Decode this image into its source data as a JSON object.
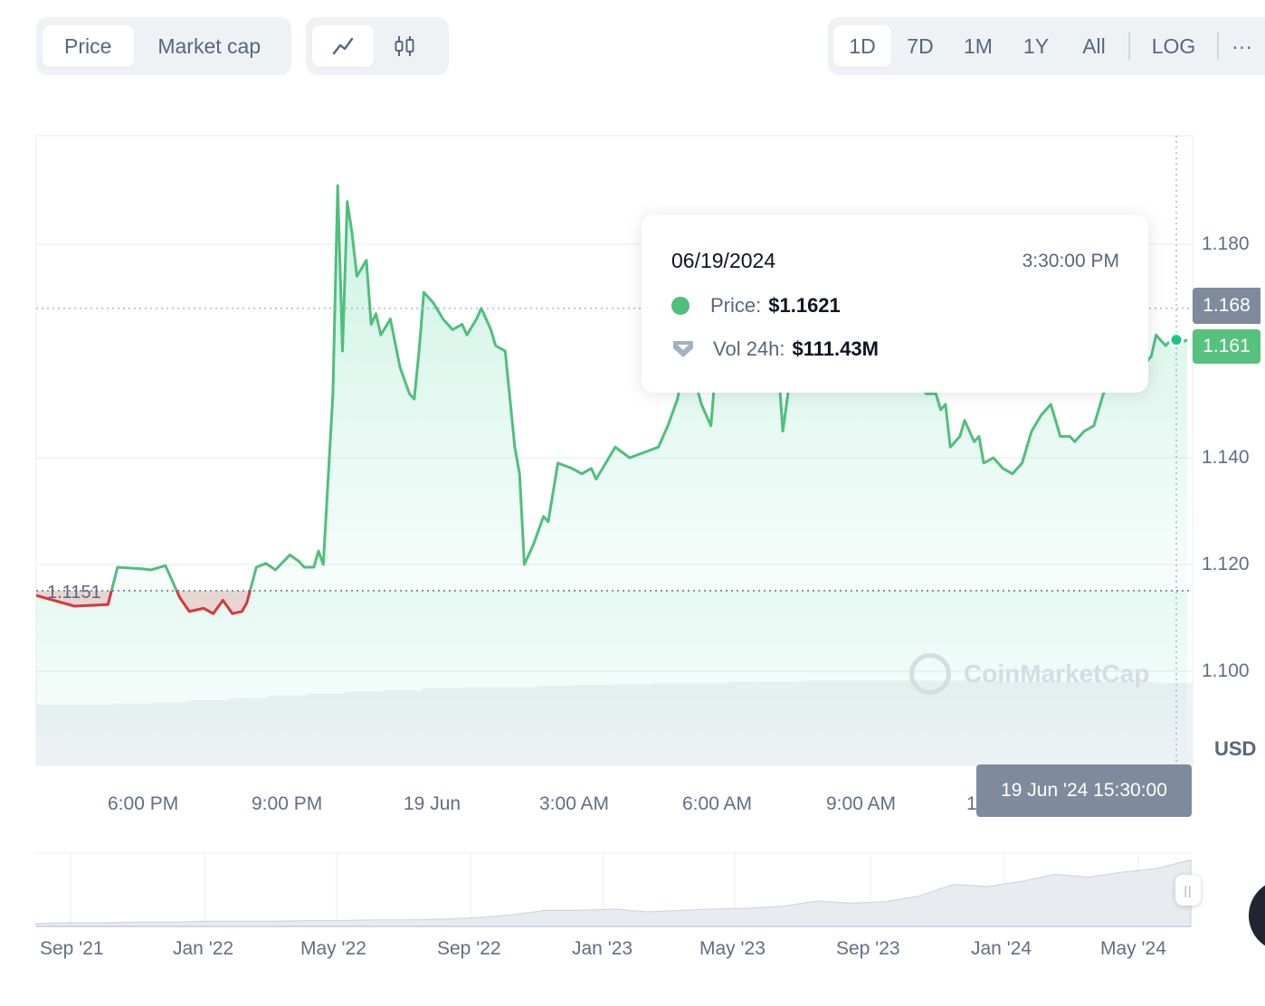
{
  "toolbar": {
    "type_tabs": [
      "Price",
      "Market cap"
    ],
    "active_type": "Price",
    "range_tabs": [
      "1D",
      "7D",
      "1M",
      "1Y",
      "All"
    ],
    "active_range": "1D",
    "log_label": "LOG",
    "more_label": "···",
    "view_icons": [
      "line-chart-icon",
      "candlestick-icon"
    ]
  },
  "tooltip": {
    "date": "06/19/2024",
    "time": "3:30:00 PM",
    "price_label": "Price:",
    "price_value": "$1.1621",
    "volume_label": "Vol 24h:",
    "volume_value": "$111.43M"
  },
  "chart_data": {
    "type": "area",
    "currency": "USD",
    "baseline": 1.1151,
    "baseline_label": "1.1151",
    "ylim": [
      1.082,
      1.19
    ],
    "yticks": [
      1.1,
      1.12,
      1.14,
      1.18
    ],
    "ytick_labels": [
      "1.100",
      "1.120",
      "1.140",
      "1.180"
    ],
    "xticks": [
      "6:00 PM",
      "9:00 PM",
      "19 Jun",
      "3:00 AM",
      "6:00 AM",
      "9:00 AM",
      "1"
    ],
    "current_price_label": "1.161",
    "hover_price_label": "1.168",
    "hover_time_label": "19 Jun '24 15:30:00",
    "up_color": "#16c784",
    "down_color": "#ea3943",
    "x_start_hours": 15.7,
    "x_end_hours": 39.75,
    "series": [
      {
        "points": [
          [
            15.7,
            1.1142
          ],
          [
            16.5,
            1.1122
          ],
          [
            17.2,
            1.1125
          ],
          [
            17.4,
            1.1195
          ],
          [
            17.9,
            1.1192
          ],
          [
            18.1,
            1.119
          ],
          [
            18.4,
            1.1198
          ],
          [
            18.7,
            1.1138
          ],
          [
            18.9,
            1.1112
          ],
          [
            19.2,
            1.1118
          ],
          [
            19.4,
            1.1108
          ],
          [
            19.6,
            1.1133
          ],
          [
            19.8,
            1.1108
          ],
          [
            20.0,
            1.1112
          ],
          [
            20.1,
            1.1128
          ],
          [
            20.3,
            1.1195
          ],
          [
            20.5,
            1.1202
          ],
          [
            20.7,
            1.119
          ],
          [
            21.0,
            1.1218
          ],
          [
            21.2,
            1.1205
          ],
          [
            21.3,
            1.1195
          ],
          [
            21.5,
            1.1195
          ],
          [
            21.6,
            1.1225
          ],
          [
            21.7,
            1.12
          ],
          [
            21.9,
            1.152
          ],
          [
            22.0,
            1.191
          ],
          [
            22.1,
            1.16
          ],
          [
            22.2,
            1.188
          ],
          [
            22.3,
            1.182
          ],
          [
            22.4,
            1.174
          ],
          [
            22.6,
            1.177
          ],
          [
            22.7,
            1.165
          ],
          [
            22.8,
            1.167
          ],
          [
            22.9,
            1.163
          ],
          [
            23.1,
            1.166
          ],
          [
            23.3,
            1.157
          ],
          [
            23.5,
            1.152
          ],
          [
            23.6,
            1.151
          ],
          [
            23.7,
            1.16
          ],
          [
            23.8,
            1.171
          ],
          [
            24.0,
            1.169
          ],
          [
            24.2,
            1.166
          ],
          [
            24.4,
            1.164
          ],
          [
            24.6,
            1.165
          ],
          [
            24.7,
            1.163
          ],
          [
            24.9,
            1.166
          ],
          [
            25.0,
            1.168
          ],
          [
            25.2,
            1.164
          ],
          [
            25.3,
            1.161
          ],
          [
            25.5,
            1.16
          ],
          [
            25.7,
            1.142
          ],
          [
            25.8,
            1.137
          ],
          [
            25.9,
            1.12
          ],
          [
            26.1,
            1.124
          ],
          [
            26.3,
            1.129
          ],
          [
            26.4,
            1.128
          ],
          [
            26.6,
            1.139
          ],
          [
            26.9,
            1.138
          ],
          [
            27.1,
            1.137
          ],
          [
            27.3,
            1.138
          ],
          [
            27.4,
            1.136
          ],
          [
            27.6,
            1.139
          ],
          [
            27.8,
            1.142
          ],
          [
            28.1,
            1.14
          ],
          [
            28.4,
            1.141
          ],
          [
            28.7,
            1.142
          ],
          [
            28.9,
            1.146
          ],
          [
            29.1,
            1.151
          ],
          [
            29.3,
            1.16
          ],
          [
            29.6,
            1.15
          ],
          [
            29.8,
            1.146
          ],
          [
            29.9,
            1.157
          ],
          [
            30.1,
            1.156
          ],
          [
            30.3,
            1.158
          ],
          [
            30.5,
            1.156
          ],
          [
            30.6,
            1.159
          ],
          [
            30.8,
            1.157
          ],
          [
            31.0,
            1.156
          ],
          [
            31.2,
            1.158
          ],
          [
            31.3,
            1.145
          ],
          [
            31.5,
            1.158
          ],
          [
            31.7,
            1.156
          ],
          [
            31.9,
            1.163
          ],
          [
            32.1,
            1.155
          ],
          [
            32.3,
            1.157
          ],
          [
            32.5,
            1.154
          ],
          [
            32.7,
            1.154
          ],
          [
            32.9,
            1.158
          ],
          [
            33.1,
            1.163
          ],
          [
            33.3,
            1.157
          ],
          [
            33.5,
            1.155
          ],
          [
            33.7,
            1.156
          ],
          [
            33.9,
            1.155
          ],
          [
            34.0,
            1.155
          ],
          [
            34.2,
            1.153
          ],
          [
            34.3,
            1.152
          ],
          [
            34.5,
            1.152
          ],
          [
            34.6,
            1.149
          ],
          [
            34.7,
            1.15
          ],
          [
            34.8,
            1.142
          ],
          [
            35.0,
            1.144
          ],
          [
            35.1,
            1.147
          ],
          [
            35.3,
            1.143
          ],
          [
            35.4,
            1.144
          ],
          [
            35.5,
            1.139
          ],
          [
            35.7,
            1.14
          ],
          [
            35.9,
            1.138
          ],
          [
            36.1,
            1.137
          ],
          [
            36.3,
            1.139
          ],
          [
            36.5,
            1.145
          ],
          [
            36.7,
            1.148
          ],
          [
            36.9,
            1.15
          ],
          [
            37.1,
            1.144
          ],
          [
            37.3,
            1.144
          ],
          [
            37.4,
            1.143
          ],
          [
            37.6,
            1.145
          ],
          [
            37.8,
            1.146
          ],
          [
            38.0,
            1.152
          ],
          [
            38.2,
            1.155
          ],
          [
            38.4,
            1.157
          ],
          [
            38.6,
            1.158
          ],
          [
            38.8,
            1.157
          ],
          [
            39.0,
            1.159
          ],
          [
            39.1,
            1.163
          ],
          [
            39.2,
            1.162
          ],
          [
            39.3,
            1.161
          ],
          [
            39.4,
            1.162
          ],
          [
            39.5,
            1.161
          ],
          [
            39.6,
            1.1615
          ],
          [
            39.75,
            1.1621
          ]
        ]
      }
    ],
    "volume_relative": [
      0.56,
      0.56,
      0.57,
      0.58,
      0.6,
      0.62,
      0.64,
      0.66,
      0.68,
      0.69,
      0.71,
      0.72,
      0.72,
      0.73,
      0.74,
      0.75,
      0.76,
      0.76,
      0.77,
      0.77,
      0.78,
      0.78,
      0.78,
      0.78,
      0.78,
      0.77,
      0.77,
      0.77,
      0.77,
      0.76
    ]
  },
  "navigator": {
    "labels": [
      "Sep '21",
      "Jan '22",
      "May '22",
      "Sep '22",
      "Jan '23",
      "May '23",
      "Sep '23",
      "Jan '24",
      "May '24"
    ],
    "handle_glyph": "||"
  },
  "watermark": "CoinMarketCap"
}
